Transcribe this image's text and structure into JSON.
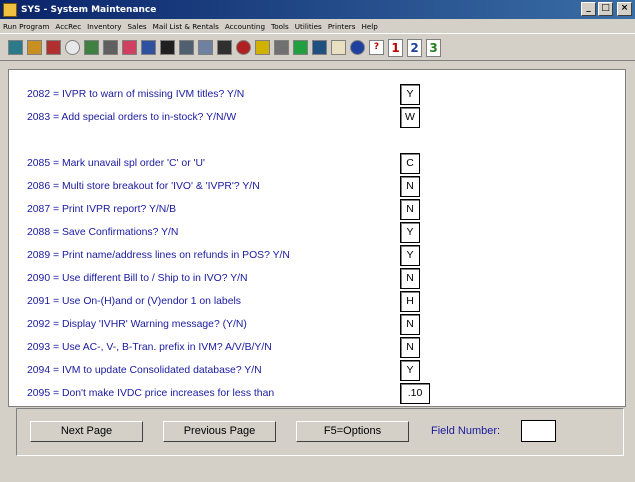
{
  "window": {
    "title": "SYS - System Maintenance"
  },
  "menu": [
    "Run Program",
    "AccRec",
    "Inventory",
    "Sales",
    "Mail List & Rentals",
    "Accounting",
    "Tools",
    "Utilities",
    "Printers",
    "Help"
  ],
  "toolbar": {
    "numbers": [
      "1",
      "2",
      "3"
    ],
    "help_label": "?"
  },
  "settings": [
    {
      "label": "2082 = IVPR to warn of missing IVM titles? Y/N",
      "value": "Y"
    },
    {
      "label": "2083 = Add special orders to in-stock? Y/N/W",
      "value": "W"
    },
    {
      "label": "2085 = Mark unavail spl order 'C' or 'U'",
      "value": "C"
    },
    {
      "label": "2086 = Multi store breakout for 'IVO' & 'IVPR'? Y/N",
      "value": "N"
    },
    {
      "label": "2087 = Print IVPR report? Y/N/B",
      "value": "N"
    },
    {
      "label": "2088 = Save Confirmations? Y/N",
      "value": "Y"
    },
    {
      "label": "2089 = Print name/address lines on refunds in POS? Y/N",
      "value": "Y"
    },
    {
      "label": "2090 = Use different Bill to / Ship to in IVO? Y/N",
      "value": "N"
    },
    {
      "label": "2091 = Use On-(H)and or (V)endor 1 on labels",
      "value": "H"
    },
    {
      "label": "2092 = Display 'IVHR' Warning message? (Y/N)",
      "value": "N"
    },
    {
      "label": "2093 = Use AC-, V-, B-Tran. prefix in IVM? A/V/B/Y/N",
      "value": "N"
    },
    {
      "label": "2094 = IVM to update Consolidated database? Y/N",
      "value": "Y"
    },
    {
      "label": "2095 = Don't make IVDC price increases for less than",
      "value": ".10"
    }
  ],
  "buttons": {
    "next": "Next Page",
    "previous": "Previous Page",
    "options": "F5=Options"
  },
  "field_number": {
    "label": "Field Number:",
    "value": ""
  }
}
